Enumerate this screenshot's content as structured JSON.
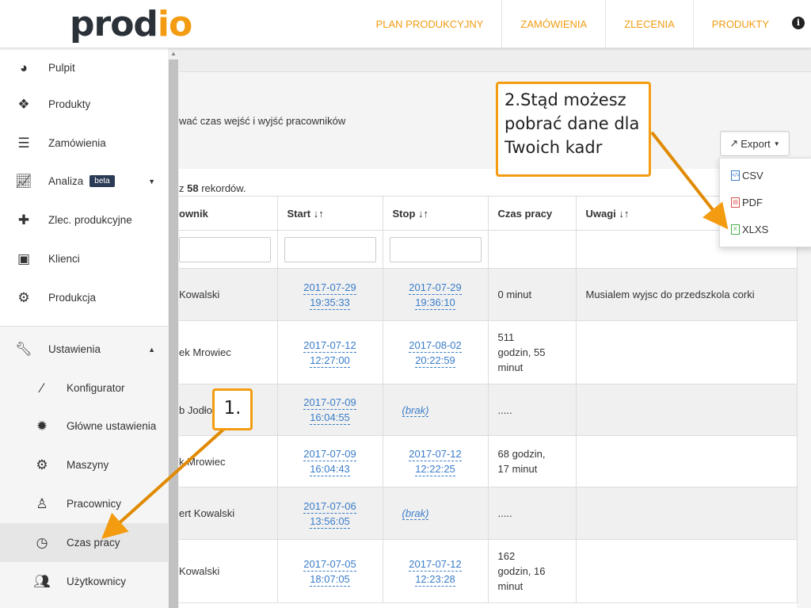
{
  "brand": {
    "logo_text": "prod",
    "logo_gear": "io"
  },
  "topnav": [
    {
      "label": "PLAN PRODUKCYJNY"
    },
    {
      "label": "ZAMÓWIENIA"
    },
    {
      "label": "ZLECENIA"
    },
    {
      "label": "PRODUKTY"
    }
  ],
  "sidebar": {
    "items": [
      {
        "label": "Pulpit",
        "icon": "dashboard-icon"
      },
      {
        "label": "Produkty",
        "icon": "cubes-icon"
      },
      {
        "label": "Zamówienia",
        "icon": "tasks-icon"
      },
      {
        "label": "Analiza",
        "icon": "chart-icon",
        "badge": "beta"
      },
      {
        "label": "Zlec. produkcyjne",
        "icon": "puzzle-icon"
      },
      {
        "label": "Klienci",
        "icon": "briefcase-icon"
      },
      {
        "label": "Produkcja",
        "icon": "cogs-icon"
      },
      {
        "label": "Ustawienia",
        "icon": "wrench-icon"
      }
    ],
    "subitems": [
      {
        "label": "Konfigurator",
        "icon": "magic-wand-icon"
      },
      {
        "label": "Główne ustawienia",
        "icon": "cog-icon"
      },
      {
        "label": "Maszyny",
        "icon": "cogs-icon"
      },
      {
        "label": "Pracownicy",
        "icon": "person-icon"
      },
      {
        "label": "Czas pracy",
        "icon": "clock-icon"
      },
      {
        "label": "Użytkownicy",
        "icon": "users-icon"
      }
    ]
  },
  "page": {
    "description": "wać czas wejść i wyjść pracowników",
    "records_prefix": "z ",
    "records_count": "58",
    "records_suffix": " rekordów."
  },
  "export": {
    "label": "Export",
    "options": [
      "CSV",
      "PDF",
      "XLXS"
    ]
  },
  "table": {
    "headers": [
      "ownik",
      "Start ↓↑",
      "Stop ↓↑",
      "Czas pracy",
      "Uwagi ↓↑"
    ],
    "rows": [
      {
        "name": "Kowalski",
        "start_date": "2017-07-29",
        "start_time": "19:35:33",
        "stop_date": "2017-07-29",
        "stop_time": "19:36:10",
        "czas1": "0 minut",
        "czas2": "",
        "czas3": "",
        "uwagi": "Musialem wyjsc do przedszkola corki"
      },
      {
        "name": "ek Mrowiec",
        "start_date": "2017-07-12",
        "start_time": "12:27:00",
        "stop_date": "2017-08-02",
        "stop_time": "20:22:59",
        "czas1": "511",
        "czas2": "godzin, 55",
        "czas3": "minut",
        "uwagi": ""
      },
      {
        "name": "b Jodło",
        "start_date": "2017-07-09",
        "start_time": "16:04:55",
        "stop_brak": "(brak)",
        "czas1": ".....",
        "czas2": "",
        "czas3": "",
        "uwagi": ""
      },
      {
        "name": "k Mrowiec",
        "start_date": "2017-07-09",
        "start_time": "16:04:43",
        "stop_date": "2017-07-12",
        "stop_time": "12:22:25",
        "czas1": "68 godzin,",
        "czas2": "17 minut",
        "czas3": "",
        "uwagi": ""
      },
      {
        "name": "ert Kowalski",
        "start_date": "2017-07-06",
        "start_time": "13:56:05",
        "stop_brak": "(brak)",
        "czas1": ".....",
        "czas2": "",
        "czas3": "",
        "uwagi": ""
      },
      {
        "name": "Kowalski",
        "start_date": "2017-07-05",
        "start_time": "18:07:05",
        "stop_date": "2017-07-12",
        "stop_time": "12:23:28",
        "czas1": "162",
        "czas2": "godzin, 16",
        "czas3": "minut",
        "uwagi": ""
      }
    ]
  },
  "callouts": {
    "step1": "1.",
    "step2_line1": "2.Stąd możesz",
    "step2_line2": "pobrać dane dla",
    "step2_line3": "Twoich kadr"
  },
  "colors": {
    "accent": "#f39c12",
    "link": "#3a7dc9",
    "dark": "#2b3138"
  }
}
